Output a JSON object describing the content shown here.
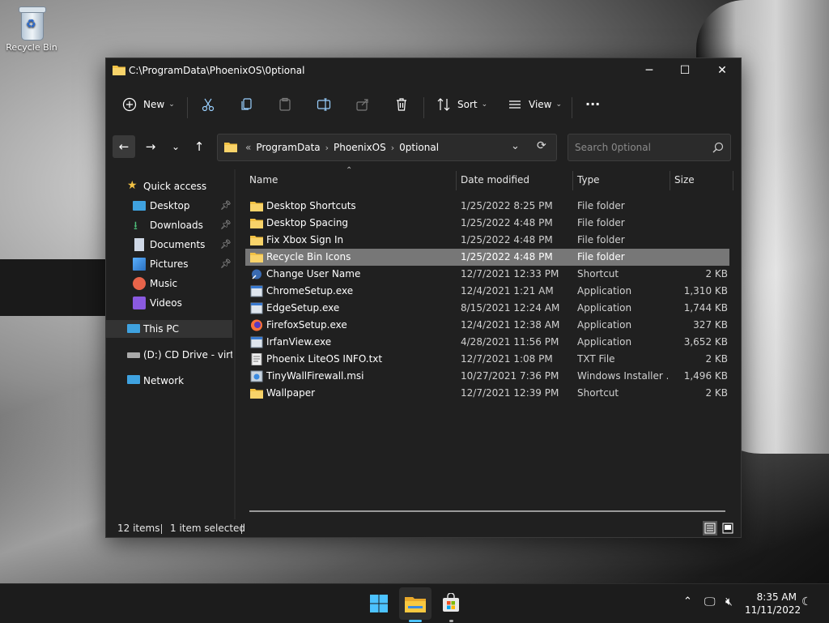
{
  "desktop": {
    "icons": [
      {
        "label": "Recycle Bin",
        "icon": "recycle-bin-icon"
      }
    ]
  },
  "window": {
    "title": "C:\\ProgramData\\PhoenixOS\\0ptional",
    "controls": {
      "minimize": "─",
      "maximize": "☐",
      "close": "✕"
    }
  },
  "command_bar": {
    "new_label": "New",
    "sort_label": "Sort",
    "view_label": "View",
    "more_label": "···"
  },
  "address_bar": {
    "overflow": "«",
    "crumbs": [
      "ProgramData",
      "PhoenixOS",
      "0ptional"
    ],
    "search_placeholder": "Search 0ptional"
  },
  "nav_pane": {
    "quick_access": "Quick access",
    "pinned": [
      {
        "label": "Desktop",
        "icon": "desktop-icon",
        "pinned": true
      },
      {
        "label": "Downloads",
        "icon": "downloads-icon",
        "pinned": true
      },
      {
        "label": "Documents",
        "icon": "documents-icon",
        "pinned": true
      },
      {
        "label": "Pictures",
        "icon": "pictures-icon",
        "pinned": true
      },
      {
        "label": "Music",
        "icon": "music-icon",
        "pinned": false
      },
      {
        "label": "Videos",
        "icon": "videos-icon",
        "pinned": false
      }
    ],
    "this_pc": "This PC",
    "cd_drive": "(D:) CD Drive - virtio-",
    "network": "Network"
  },
  "file_list": {
    "columns": [
      "Name",
      "Date modified",
      "Type",
      "Size"
    ],
    "rows": [
      {
        "name": "Desktop Shortcuts",
        "date": "1/25/2022 8:25 PM",
        "type": "File folder",
        "size": "",
        "icon": "folder-icon"
      },
      {
        "name": "Desktop Spacing",
        "date": "1/25/2022 4:48 PM",
        "type": "File folder",
        "size": "",
        "icon": "folder-icon"
      },
      {
        "name": "Fix Xbox Sign In",
        "date": "1/25/2022 4:48 PM",
        "type": "File folder",
        "size": "",
        "icon": "folder-icon"
      },
      {
        "name": "Recycle Bin Icons",
        "date": "1/25/2022 4:48 PM",
        "type": "File folder",
        "size": "",
        "icon": "folder-icon",
        "selected": true
      },
      {
        "name": "Change User Name",
        "date": "12/7/2021 12:33 PM",
        "type": "Shortcut",
        "size": "2 KB",
        "icon": "shortcut-icon"
      },
      {
        "name": "ChromeSetup.exe",
        "date": "12/4/2021 1:21 AM",
        "type": "Application",
        "size": "1,310 KB",
        "icon": "application-icon"
      },
      {
        "name": "EdgeSetup.exe",
        "date": "8/15/2021 12:24 AM",
        "type": "Application",
        "size": "1,744 KB",
        "icon": "application-icon"
      },
      {
        "name": "FirefoxSetup.exe",
        "date": "12/4/2021 12:38 AM",
        "type": "Application",
        "size": "327 KB",
        "icon": "firefox-icon"
      },
      {
        "name": "IrfanView.exe",
        "date": "4/28/2021 11:56 PM",
        "type": "Application",
        "size": "3,652 KB",
        "icon": "application-icon"
      },
      {
        "name": "Phoenix LiteOS INFO.txt",
        "date": "12/7/2021 1:08 PM",
        "type": "TXT File",
        "size": "2 KB",
        "icon": "text-file-icon"
      },
      {
        "name": "TinyWallFirewall.msi",
        "date": "10/27/2021 7:36 PM",
        "type": "Windows Installer ...",
        "size": "1,496 KB",
        "icon": "installer-icon"
      },
      {
        "name": "Wallpaper",
        "date": "12/7/2021 12:39 PM",
        "type": "Shortcut",
        "size": "2 KB",
        "icon": "folder-icon"
      }
    ]
  },
  "status_bar": {
    "item_count": "12 items",
    "selection": "1 item selected"
  },
  "taskbar": {
    "apps": [
      {
        "name": "start",
        "icon": "windows-start-icon"
      },
      {
        "name": "file-explorer",
        "icon": "file-explorer-icon",
        "active": true
      },
      {
        "name": "store",
        "icon": "store-icon"
      }
    ],
    "time": "8:35 AM",
    "date": "11/11/2022"
  },
  "colors": {
    "window_bg": "#202020",
    "selection": "#777777",
    "folder_yellow": "#f3c244",
    "accent_blue": "#4cc2ff"
  }
}
